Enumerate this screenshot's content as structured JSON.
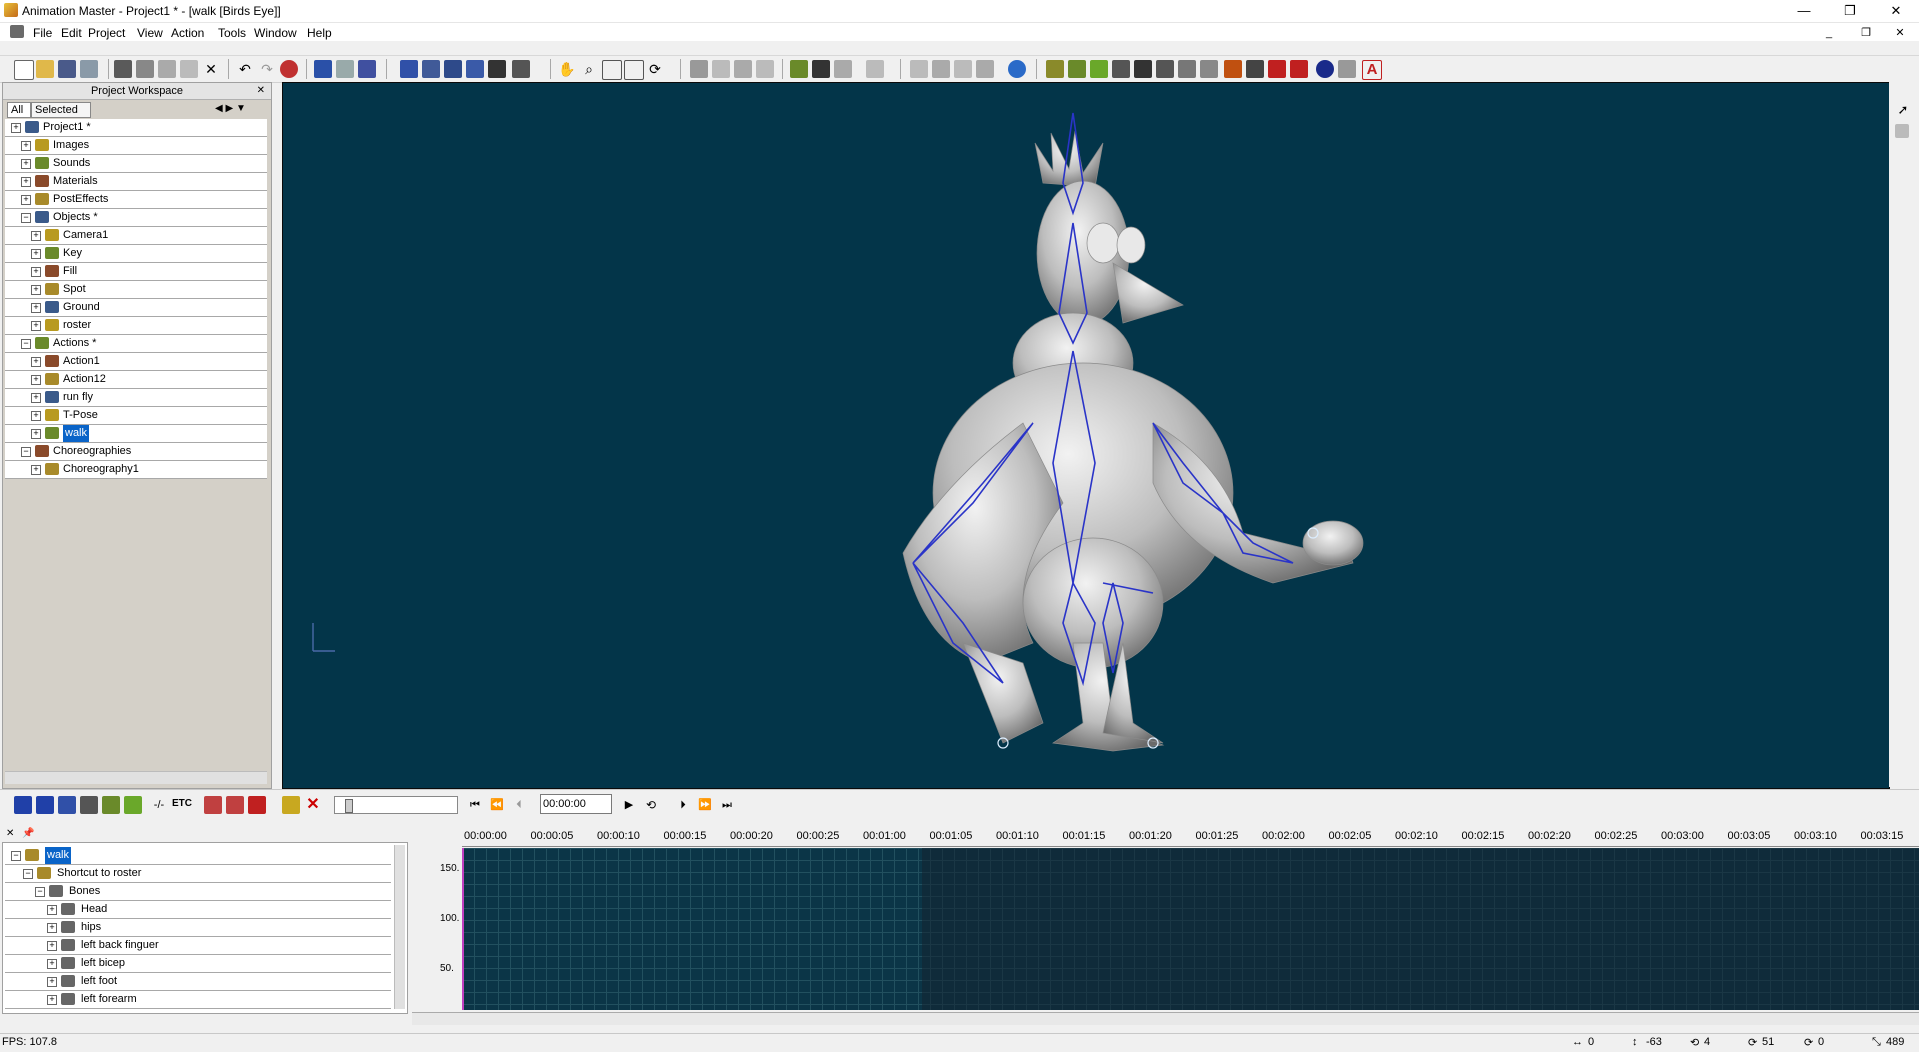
{
  "window": {
    "title": "Animation Master - Project1 * - [walk [Birds Eye]]",
    "minimize": "—",
    "maximize": "❐",
    "close": "✕"
  },
  "menubar": {
    "items": [
      "File",
      "Edit",
      "Project",
      "View",
      "Action",
      "Tools",
      "Window",
      "Help"
    ]
  },
  "mdi": {
    "minimize": "_",
    "restore": "❐",
    "close": "✕"
  },
  "workspace": {
    "title": "Project Workspace",
    "tabs": [
      "All",
      "Selected"
    ],
    "tree": [
      {
        "label": "Project1 *",
        "indent": 0
      },
      {
        "label": "Images",
        "indent": 1
      },
      {
        "label": "Sounds",
        "indent": 1
      },
      {
        "label": "Materials",
        "indent": 1
      },
      {
        "label": "PostEffects",
        "indent": 1
      },
      {
        "label": "Objects *",
        "indent": 1
      },
      {
        "label": "Camera1",
        "indent": 2
      },
      {
        "label": "Key",
        "indent": 2
      },
      {
        "label": "Fill",
        "indent": 2
      },
      {
        "label": "Spot",
        "indent": 2
      },
      {
        "label": "Ground",
        "indent": 2
      },
      {
        "label": "roster",
        "indent": 2
      },
      {
        "label": "Actions *",
        "indent": 1
      },
      {
        "label": "Action1",
        "indent": 2
      },
      {
        "label": "Action12",
        "indent": 2
      },
      {
        "label": "run fly",
        "indent": 2
      },
      {
        "label": "T-Pose",
        "indent": 2
      },
      {
        "label": "walk",
        "indent": 2,
        "selected": true
      },
      {
        "label": "Choreographies",
        "indent": 1
      },
      {
        "label": "Choreography1",
        "indent": 2
      }
    ]
  },
  "playbar": {
    "time": "00:00:00",
    "etc_label": "ETC"
  },
  "timeline_tree": [
    {
      "label": "walk",
      "indent": 0,
      "selected": true
    },
    {
      "label": "Shortcut to roster",
      "indent": 1
    },
    {
      "label": "Bones",
      "indent": 2
    },
    {
      "label": "Head",
      "indent": 3
    },
    {
      "label": "hips",
      "indent": 3
    },
    {
      "label": "left back finguer",
      "indent": 3
    },
    {
      "label": "left bicep",
      "indent": 3
    },
    {
      "label": "left foot",
      "indent": 3
    },
    {
      "label": "left forearm",
      "indent": 3
    }
  ],
  "timeline": {
    "ruler": [
      "00:00:00",
      "00:00:05",
      "00:00:10",
      "00:00:15",
      "00:00:20",
      "00:00:25",
      "00:01:00",
      "00:01:05",
      "00:01:10",
      "00:01:15",
      "00:01:20",
      "00:01:25",
      "00:02:00",
      "00:02:05",
      "00:02:10",
      "00:02:15",
      "00:02:20",
      "00:02:25",
      "00:03:00",
      "00:03:05",
      "00:03:10",
      "00:03:15"
    ],
    "y_labels": [
      "150.",
      "100.",
      "50."
    ]
  },
  "status": {
    "fps": "FPS: 107.8",
    "x": "0",
    "y": "-63",
    "rot": "4",
    "frame": "51",
    "last": "0",
    "count": "489"
  },
  "colors": {
    "viewport_bg": "#033549",
    "bone": "#2a34c8",
    "selection": "#0a64c8"
  }
}
